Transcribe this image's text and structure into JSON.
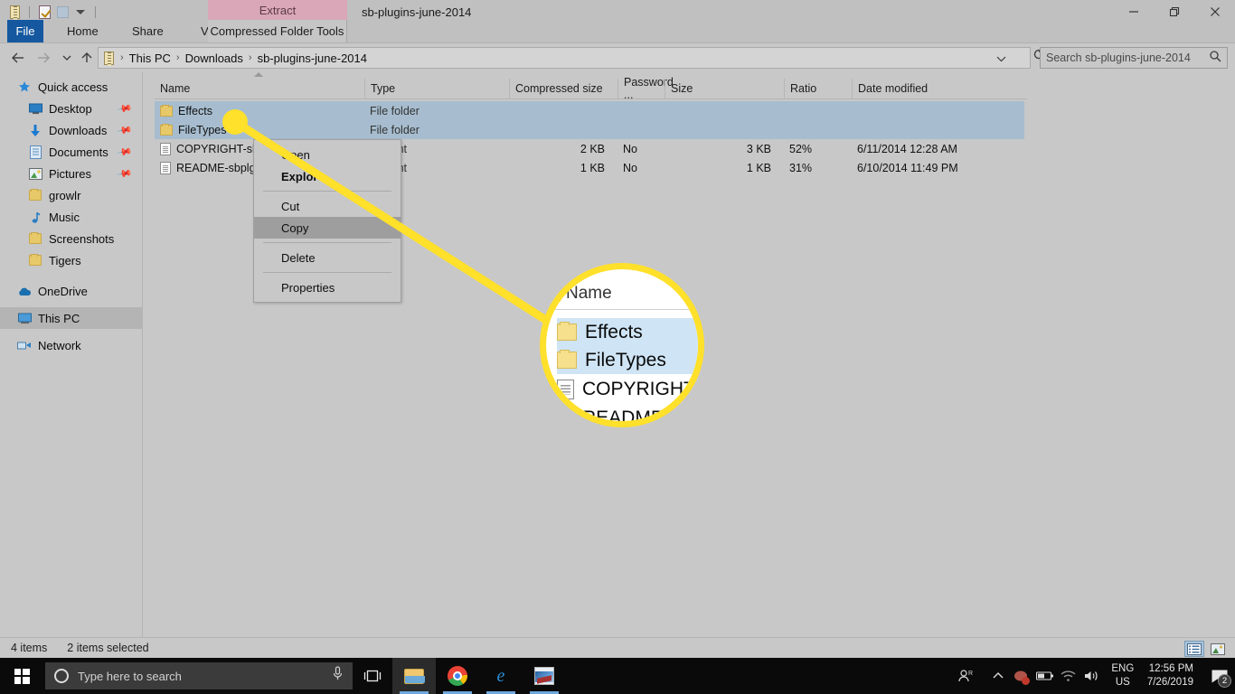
{
  "window": {
    "title": "sb-plugins-june-2014",
    "contextual_tab_header": "Extract",
    "quick_access": [
      "zip-icon",
      "properties-icon",
      "new-folder-icon",
      "qat-dropdown-caret"
    ],
    "controls": {
      "minimize": "minimize-icon",
      "restore": "restore-icon",
      "close": "close-icon"
    }
  },
  "ribbon": {
    "tabs": [
      {
        "label": "File",
        "active": true
      },
      {
        "label": "Home",
        "active": false
      },
      {
        "label": "Share",
        "active": false
      },
      {
        "label": "View",
        "active": false
      }
    ],
    "contextual_tab": "Compressed Folder Tools"
  },
  "address": {
    "breadcrumbs": [
      "This PC",
      "Downloads",
      "sb-plugins-june-2014"
    ],
    "separator": "›",
    "back": "back-arrow-icon",
    "forward": "forward-arrow-icon",
    "recent": "recent-locations-caret",
    "up": "up-arrow-icon",
    "refresh": "refresh-icon",
    "dropdown_caret": "⌄"
  },
  "search": {
    "placeholder": "Search sb-plugins-june-2014",
    "icon": "search-icon"
  },
  "sidebar": {
    "items": [
      {
        "label": "Quick access",
        "icon": "star-icon",
        "indent": false,
        "pinned": false,
        "selected": false
      },
      {
        "label": "Desktop",
        "icon": "desktop-icon",
        "indent": true,
        "pinned": true,
        "selected": false
      },
      {
        "label": "Downloads",
        "icon": "download-arrow-icon",
        "indent": true,
        "pinned": true,
        "selected": false
      },
      {
        "label": "Documents",
        "icon": "documents-icon",
        "indent": true,
        "pinned": true,
        "selected": false
      },
      {
        "label": "Pictures",
        "icon": "pictures-icon",
        "indent": true,
        "pinned": true,
        "selected": false
      },
      {
        "label": "growlr",
        "icon": "folder-icon",
        "indent": true,
        "pinned": false,
        "selected": false
      },
      {
        "label": "Music",
        "icon": "music-note-icon",
        "indent": true,
        "pinned": false,
        "selected": false
      },
      {
        "label": "Screenshots",
        "icon": "folder-icon",
        "indent": true,
        "pinned": false,
        "selected": false
      },
      {
        "label": "Tigers",
        "icon": "folder-icon",
        "indent": true,
        "pinned": false,
        "selected": false
      }
    ],
    "roots": [
      {
        "label": "OneDrive",
        "icon": "cloud-icon",
        "selected": false
      },
      {
        "label": "This PC",
        "icon": "computer-icon",
        "selected": true
      },
      {
        "label": "Network",
        "icon": "network-icon",
        "selected": false
      }
    ]
  },
  "filelist": {
    "columns": [
      "Name",
      "Type",
      "Compressed size",
      "Password ...",
      "Size",
      "Ratio",
      "Date modified"
    ],
    "sorted_by": "Name",
    "sort_direction": "ascending",
    "rows": [
      {
        "name": "Effects",
        "icon": "folder-icon",
        "type": "File folder",
        "compressed_size": "",
        "password": "",
        "size": "",
        "ratio": "",
        "date_modified": "",
        "selected": true
      },
      {
        "name": "FileTypes",
        "icon": "folder-icon",
        "type": "File folder",
        "compressed_size": "",
        "password": "",
        "size": "",
        "ratio": "",
        "date_modified": "",
        "selected": true
      },
      {
        "name": "COPYRIGHT-sb",
        "icon": "document-icon",
        "type": "cument",
        "compressed_size": "2 KB",
        "password": "No",
        "size": "3 KB",
        "ratio": "52%",
        "date_modified": "6/11/2014 12:28 AM",
        "selected": false
      },
      {
        "name": "README-sbplg",
        "icon": "document-icon",
        "type": "cument",
        "compressed_size": "1 KB",
        "password": "No",
        "size": "1 KB",
        "ratio": "31%",
        "date_modified": "6/10/2014 11:49 PM",
        "selected": false
      }
    ]
  },
  "context_menu": {
    "items": [
      {
        "label": "Open",
        "bold": false,
        "highlighted": false,
        "separator_after": false
      },
      {
        "label": "Explore",
        "bold": true,
        "highlighted": false,
        "separator_after": true
      },
      {
        "label": "Cut",
        "bold": false,
        "highlighted": false,
        "separator_after": false
      },
      {
        "label": "Copy",
        "bold": false,
        "highlighted": true,
        "separator_after": true
      },
      {
        "label": "Delete",
        "bold": false,
        "highlighted": false,
        "separator_after": true
      },
      {
        "label": "Properties",
        "bold": false,
        "highlighted": false,
        "separator_after": false
      }
    ]
  },
  "magnifier": {
    "header": "Name",
    "rows": [
      {
        "label": "Effects",
        "icon": "folder-icon",
        "selected": true
      },
      {
        "label": "FileTypes",
        "icon": "folder-icon",
        "selected": true
      },
      {
        "label": "COPYRIGHT-",
        "icon": "document-icon",
        "selected": false
      },
      {
        "label": "README",
        "icon": "document-icon",
        "selected": false
      }
    ],
    "accent_color": "#ffe02a"
  },
  "statusbar": {
    "item_count": "4 items",
    "selection": "2 items selected",
    "views": [
      {
        "name": "details-view-button",
        "active": true
      },
      {
        "name": "large-icons-view-button",
        "active": false
      }
    ]
  },
  "taskbar": {
    "start": "windows-start-icon",
    "search_placeholder": "Type here to search",
    "cortana_icon": "cortana-circle-icon",
    "mic_icon": "microphone-icon",
    "taskview_icon": "task-view-icon",
    "apps": [
      {
        "name": "file-explorer-taskbar-icon",
        "active": true
      },
      {
        "name": "chrome-taskbar-icon",
        "active": false
      },
      {
        "name": "edge-taskbar-icon",
        "active": false
      },
      {
        "name": "photos-taskbar-icon",
        "active": false
      }
    ],
    "tray": {
      "people": "people-icon",
      "chevron": "show-hidden-icons-caret",
      "app": "tray-app-icon",
      "battery": "battery-icon",
      "network": "wifi-icon",
      "volume": "volume-icon",
      "language_top": "ENG",
      "language_bottom": "US",
      "time": "12:56 PM",
      "date": "7/26/2019",
      "notifications_icon": "action-center-icon",
      "notifications_count": "2"
    }
  }
}
